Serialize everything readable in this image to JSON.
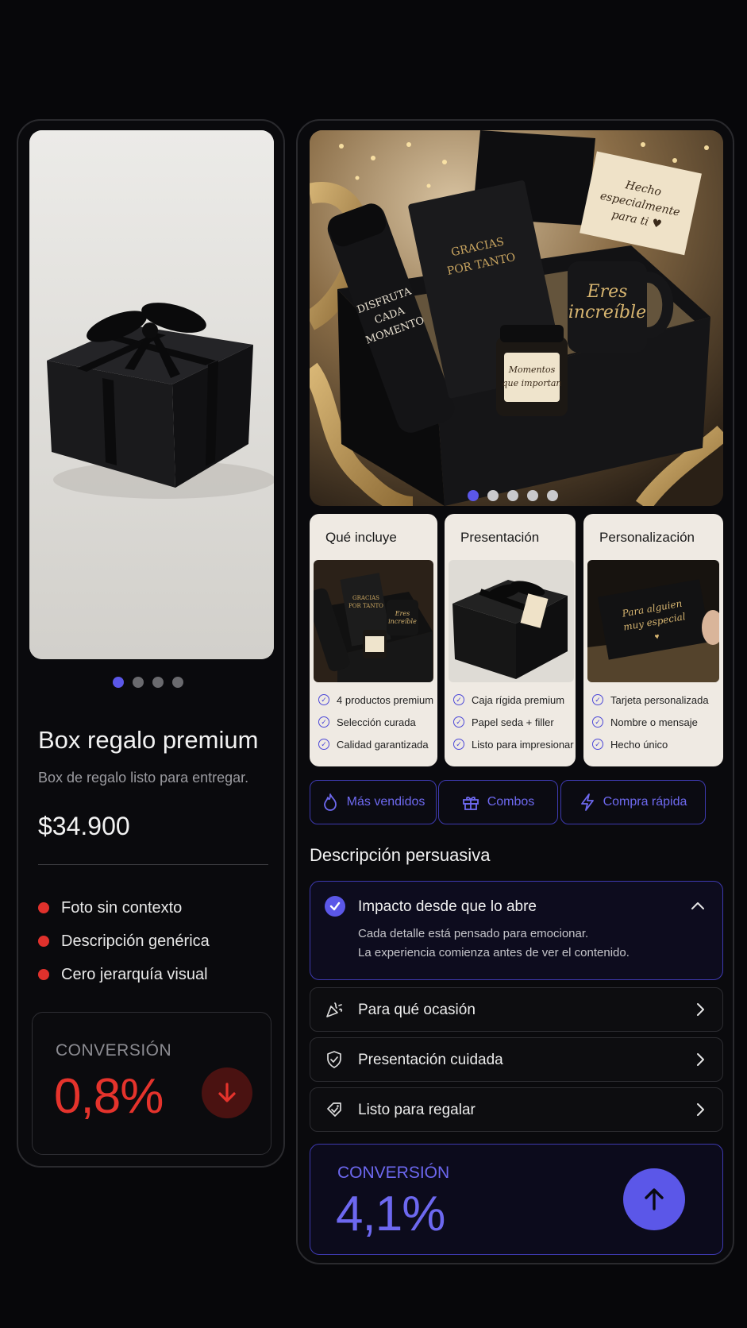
{
  "left": {
    "dots": 4,
    "active_dot": 0,
    "title": "Box regalo premium",
    "subtitle": "Box de regalo listo para entregar.",
    "price": "$34.900",
    "bullets": [
      "Foto sin contexto",
      "Descripción genérica",
      "Cero jerarquía visual"
    ],
    "conversion_label": "CONVERSIÓN",
    "conversion_value": "0,8%",
    "conversion_color": "#e5332c",
    "trend_icon": "arrow-down-icon"
  },
  "right": {
    "hero": {
      "dots": 5,
      "active_dot": 0,
      "thermos_text": "DISFRUTA CADA MOMENTO",
      "book_text": "GRACIAS POR TANTO",
      "card_text": "Hecho especialmente para ti ♥",
      "mug_text": "Eres increíble",
      "candle_text": "Momentos que importan"
    },
    "features": [
      {
        "title": "Qué incluye",
        "items": [
          "4 productos premium",
          "Selección curada",
          "Calidad garantizada"
        ]
      },
      {
        "title": "Presentación",
        "items": [
          "Caja rígida premium",
          "Papel seda + filler",
          "Listo para impresionar"
        ]
      },
      {
        "title": "Personalización",
        "items": [
          "Tarjeta personalizada",
          "Nombre o mensaje",
          "Hecho único"
        ],
        "card_text": "Para alguien muy especial"
      }
    ],
    "pills": [
      {
        "label": "Más vendidos",
        "icon": "flame-icon"
      },
      {
        "label": "Combos",
        "icon": "gift-icon"
      },
      {
        "label": "Compra rápida",
        "icon": "lightning-icon"
      }
    ],
    "description_title": "Descripción persuasiva",
    "accordion_open": {
      "title": "Impacto desde que lo abre",
      "line1": "Cada detalle está pensado para emocionar.",
      "line2": "La experiencia comienza antes de ver el contenido."
    },
    "accordion": [
      {
        "title": "Para qué ocasión",
        "icon": "party-popper-icon"
      },
      {
        "title": "Presentación cuidada",
        "icon": "shield-check-icon"
      },
      {
        "title": "Listo para regalar",
        "icon": "gift-check-icon"
      }
    ],
    "conversion_label": "CONVERSIÓN",
    "conversion_value": "4,1%",
    "conversion_color": "#6d68f0",
    "trend_icon": "arrow-up-icon"
  },
  "colors": {
    "accent": "#5b57e8",
    "negative": "#e0312c",
    "background": "#07070a"
  }
}
